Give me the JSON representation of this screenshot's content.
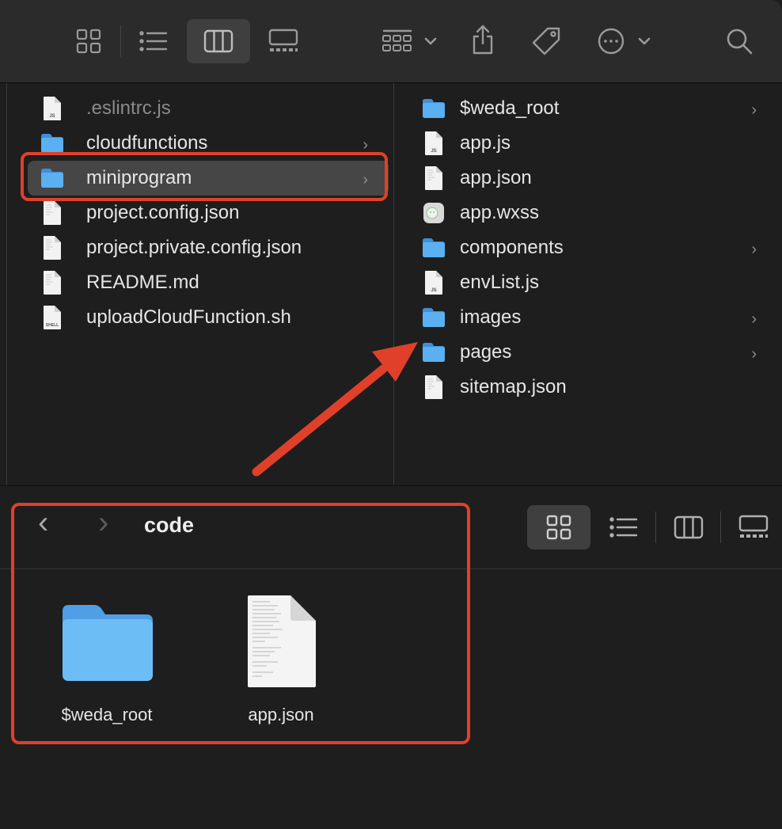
{
  "top_window": {
    "toolbar": {
      "icons": [
        "icon-view-icon",
        "list-view-icon",
        "column-view-icon",
        "gallery-view-icon",
        "group-by-icon",
        "share-icon",
        "tag-icon",
        "more-actions-icon",
        "search-icon"
      ]
    },
    "column1": {
      "items": [
        {
          "label": ".eslintrc.js",
          "type": "js",
          "dim": true,
          "has_children": false
        },
        {
          "label": "cloudfunctions",
          "type": "folder",
          "dim": false,
          "has_children": true
        },
        {
          "label": "miniprogram",
          "type": "folder",
          "dim": false,
          "has_children": true,
          "selected": true
        },
        {
          "label": "project.config.json",
          "type": "file",
          "dim": false,
          "has_children": false
        },
        {
          "label": "project.private.config.json",
          "type": "file",
          "dim": false,
          "has_children": false
        },
        {
          "label": "README.md",
          "type": "file",
          "dim": false,
          "has_children": false
        },
        {
          "label": "uploadCloudFunction.sh",
          "type": "shell",
          "dim": false,
          "has_children": false
        }
      ]
    },
    "column2": {
      "items": [
        {
          "label": "$weda_root",
          "type": "folder",
          "has_children": true
        },
        {
          "label": "app.js",
          "type": "js",
          "has_children": false
        },
        {
          "label": "app.json",
          "type": "file",
          "has_children": false
        },
        {
          "label": "app.wxss",
          "type": "wxss",
          "has_children": false
        },
        {
          "label": "components",
          "type": "folder",
          "has_children": true
        },
        {
          "label": "envList.js",
          "type": "js",
          "has_children": false
        },
        {
          "label": "images",
          "type": "folder",
          "has_children": true
        },
        {
          "label": "pages",
          "type": "folder",
          "has_children": true
        },
        {
          "label": "sitemap.json",
          "type": "file",
          "has_children": false
        }
      ]
    },
    "chevron": "›",
    "file_badges": {
      "js": "JS",
      "shell": "SHELL"
    }
  },
  "bottom_window": {
    "back_glyph": "‹",
    "forward_glyph": "›",
    "title": "code",
    "items": [
      {
        "label": "$weda_root",
        "type": "folder"
      },
      {
        "label": "app.json",
        "type": "file"
      }
    ]
  },
  "colors": {
    "folder": "#5ab0f0",
    "highlight": "#e0402a",
    "arrow": "#e0402a"
  }
}
